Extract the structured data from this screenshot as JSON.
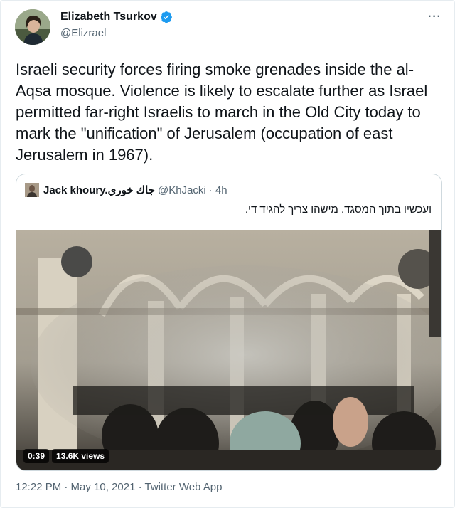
{
  "author": {
    "name": "Elizabeth Tsurkov",
    "handle": "@Elizrael",
    "verified": true
  },
  "more_label": "···",
  "tweet_text": "Israeli security forces firing smoke grenades inside the al-Aqsa mosque. Violence is likely to escalate further as Israel permitted far-right Israelis to march in the Old City today to mark the \"unification\" of Jerusalem (occupation of east Jerusalem in 1967).",
  "quoted": {
    "name": "Jack khoury.جاك خوري",
    "handle": "@KhJacki",
    "time": "· 4h",
    "text": "ועכשיו בתוך המסגד. מישהו צריך להגיד די.",
    "video": {
      "duration": "0:39",
      "views": "13.6K views"
    }
  },
  "footer": "12:22 PM · May 10, 2021 · Twitter Web App",
  "colors": {
    "verified_badge": "#1d9bf0",
    "secondary_text": "#536471",
    "border": "#cfd9de"
  },
  "icons": [
    "verified-badge-icon",
    "more-options-icon"
  ]
}
